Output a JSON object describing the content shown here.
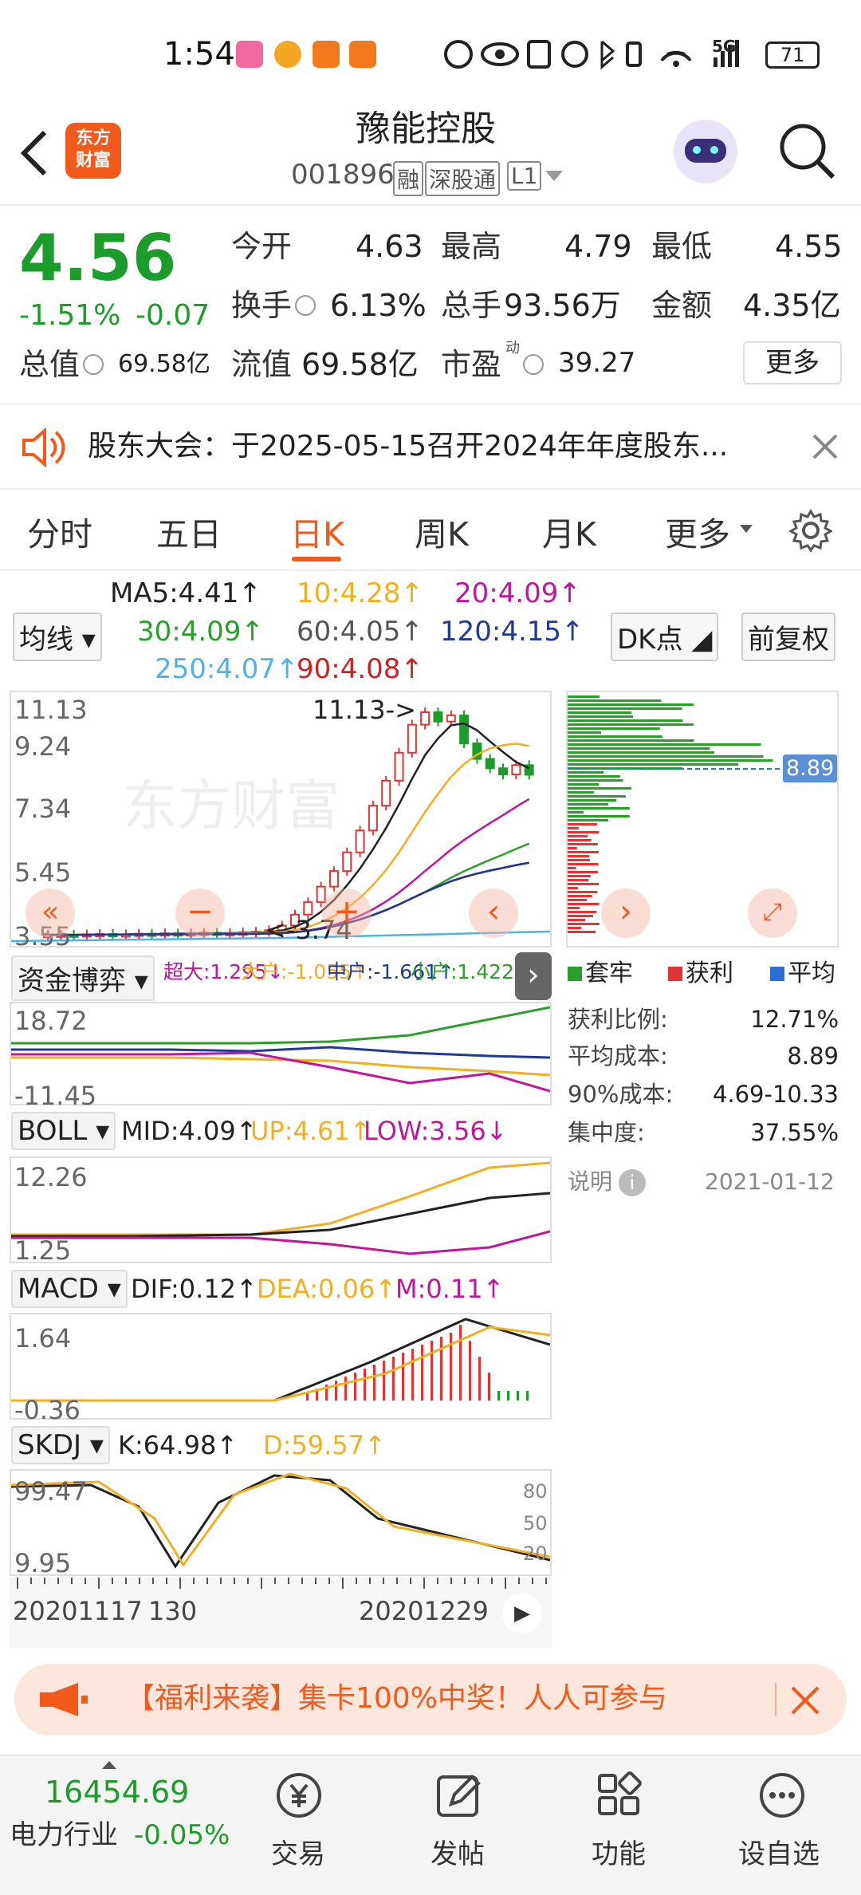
{
  "status_bar": {
    "time": "1:54",
    "battery": "71",
    "network": "5G"
  },
  "header": {
    "logo_line1": "东方",
    "logo_line2": "财富",
    "title": "豫能控股",
    "code": "001896",
    "tags": [
      "融",
      "深股通",
      "L1"
    ]
  },
  "quote": {
    "price": "4.56",
    "change_pct": "-1.51%",
    "change": "-0.07",
    "total_value_label": "总值",
    "total_value": "69.58亿",
    "open_label": "今开",
    "open": "4.63",
    "high_label": "最高",
    "high": "4.79",
    "low_label": "最低",
    "low": "4.55",
    "turnover_label": "换手",
    "turnover": "6.13%",
    "volume_label": "总手",
    "volume": "93.56万",
    "amount_label": "金额",
    "amount": "4.35亿",
    "float_label": "流值",
    "float_value": "69.58亿",
    "pe_label": "市盈",
    "pe_sup": "动",
    "pe": "39.27",
    "more_button": "更多"
  },
  "notice": {
    "text": "股东大会：于2025-05-15召开2024年年度股东..."
  },
  "tabs": [
    "分时",
    "五日",
    "日K",
    "周K",
    "月K",
    "更多"
  ],
  "active_tab": "日K",
  "ma_legend": {
    "select": "均线",
    "ma5": "MA5:4.41↑",
    "ma10": "10:4.28↑",
    "ma20": "20:4.09↑",
    "ma30": "30:4.09↑",
    "ma60": "60:4.05↑",
    "ma120": "120:4.15↑",
    "ma250": "250:4.07↑",
    "ma90": "90:4.08↑",
    "dk": "DK点",
    "fq": "前复权"
  },
  "kline": {
    "y_top": "11.13",
    "y_2": "9.24",
    "y_3": "7.34",
    "y_4": "5.45",
    "y_bottom": "3.55",
    "max_annot": "11.13->",
    "min_annot": "<-3.74",
    "watermark": "东方财富"
  },
  "chip": {
    "cost_marker": "8.89",
    "legend": [
      "套牢",
      "获利",
      "平均"
    ],
    "rows": [
      {
        "label": "获利比例:",
        "value": "12.71%"
      },
      {
        "label": "平均成本:",
        "value": "8.89"
      },
      {
        "label": "90%成本:",
        "value": "4.69-10.33"
      },
      {
        "label": "集中度:",
        "value": "37.55%"
      }
    ],
    "note_label": "说明",
    "date": "2021-01-12"
  },
  "fund": {
    "name": "资金博弈",
    "super": "超大:1.295↓",
    "large": "大户:-1.055↑",
    "mid": "中户:-1.661↑",
    "small": "小户:1.422↓",
    "y_top": "18.72",
    "y_bottom": "-11.45"
  },
  "boll": {
    "name": "BOLL",
    "mid": "MID:4.09↑",
    "up": "UP:4.61↑",
    "low": "LOW:3.56↓",
    "y_top": "12.26",
    "y_bottom": "1.25"
  },
  "macd": {
    "name": "MACD",
    "dif": "DIF:0.12↑",
    "dea": "DEA:0.06↑",
    "m": "M:0.11↑",
    "y_top": "1.64",
    "y_bottom": "-0.36"
  },
  "skdj": {
    "name": "SKDJ",
    "k": "K:64.98↑",
    "d": "D:59.57↑",
    "y_top": "99.47",
    "y_bottom": "9.95",
    "r80": "80",
    "r50": "50",
    "r20": "20"
  },
  "dates": {
    "d1": "20201117",
    "d2": "130",
    "d3": "20201229"
  },
  "promo": {
    "text": "【福利来袭】集卡100%中奖！人人可参与"
  },
  "bottom_nav": {
    "index_value": "16454.69",
    "industry": "电力行业",
    "industry_change": "-0.05%",
    "items": [
      "交易",
      "发帖",
      "功能",
      "设自选"
    ]
  },
  "colors": {
    "accent": "#f25a1c",
    "up": "#e03535",
    "down": "#1c9c2a"
  }
}
